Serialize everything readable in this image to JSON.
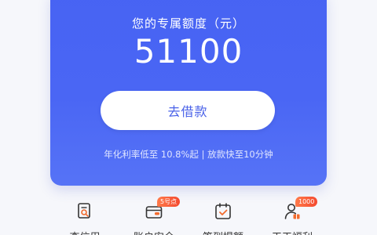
{
  "credit_card": {
    "title": "您的专属额度（元）",
    "amount": "51100",
    "button_label": "去借款",
    "note": "年化利率低至 10.8%起 | 放款快至10分钟"
  },
  "quick_menu": {
    "items": [
      {
        "label": "查信用",
        "icon": "credit-report-icon",
        "badge": ""
      },
      {
        "label": "账户安全",
        "icon": "wallet-icon",
        "badge": "5号点"
      },
      {
        "label": "签到提额",
        "icon": "calendar-check-icon",
        "badge": ""
      },
      {
        "label": "天天福利",
        "icon": "user-gift-icon",
        "badge": "1000"
      }
    ]
  },
  "colors": {
    "card_blue": "#4763f3",
    "icon_orange": "#f26b2d",
    "badge_red": "#f4492f"
  }
}
